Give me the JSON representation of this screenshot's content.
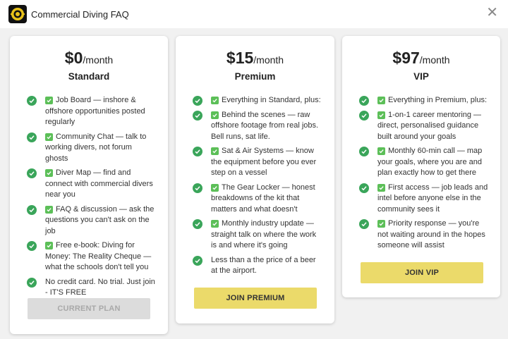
{
  "window": {
    "title": "Commercial Diving FAQ",
    "close_icon": "close-icon"
  },
  "colors": {
    "accent_yellow": "#ebda6a",
    "check_green": "#3aa55a",
    "disabled_gray": "#dcdcdc"
  },
  "plans": [
    {
      "price": "$0",
      "period": "/month",
      "name": "Standard",
      "features": [
        {
          "box": true,
          "text": "Job Board — inshore & offshore opportunities posted regularly"
        },
        {
          "box": true,
          "text": "Community Chat — talk to working divers, not forum ghosts"
        },
        {
          "box": true,
          "text": "Diver Map — find and connect with commercial divers near you"
        },
        {
          "box": true,
          "text": "FAQ & discussion — ask the questions you can't ask on the job"
        },
        {
          "box": true,
          "text": "Free e-book: Diving for Money: The Reality Cheque — what the schools don't tell you"
        },
        {
          "box": false,
          "text": "No credit card. No trial. Just join - IT'S FREE"
        }
      ],
      "button": "CURRENT PLAN"
    },
    {
      "price": "$15",
      "period": "/month",
      "name": "Premium",
      "features": [
        {
          "box": true,
          "text": "Everything in Standard, plus:"
        },
        {
          "box": true,
          "text": "Behind the scenes — raw offshore footage from real jobs. Bell runs, sat life."
        },
        {
          "box": true,
          "text": "Sat & Air Systems — know the equipment before you ever step on a vessel"
        },
        {
          "box": true,
          "text": "The Gear Locker — honest breakdowns of the kit that matters and what doesn't"
        },
        {
          "box": true,
          "text": "Monthly industry update — straight talk on where the work is and where it's going"
        },
        {
          "box": false,
          "text": "Less than a the price of a beer at the airport."
        }
      ],
      "button": "JOIN PREMIUM"
    },
    {
      "price": "$97",
      "period": "/month",
      "name": "VIP",
      "features": [
        {
          "box": true,
          "text": "Everything in Premium, plus:"
        },
        {
          "box": true,
          "text": "1-on-1 career mentoring — direct, personalised guidance built around your goals"
        },
        {
          "box": true,
          "text": "Monthly 60-min call — map your goals, where you are and plan exactly how to get there"
        },
        {
          "box": true,
          "text": "First access — job leads and intel before anyone else in the community sees it"
        },
        {
          "box": true,
          "text": "Priority response — you're not waiting around in the hopes someone will assist"
        }
      ],
      "button": "JOIN VIP"
    }
  ]
}
